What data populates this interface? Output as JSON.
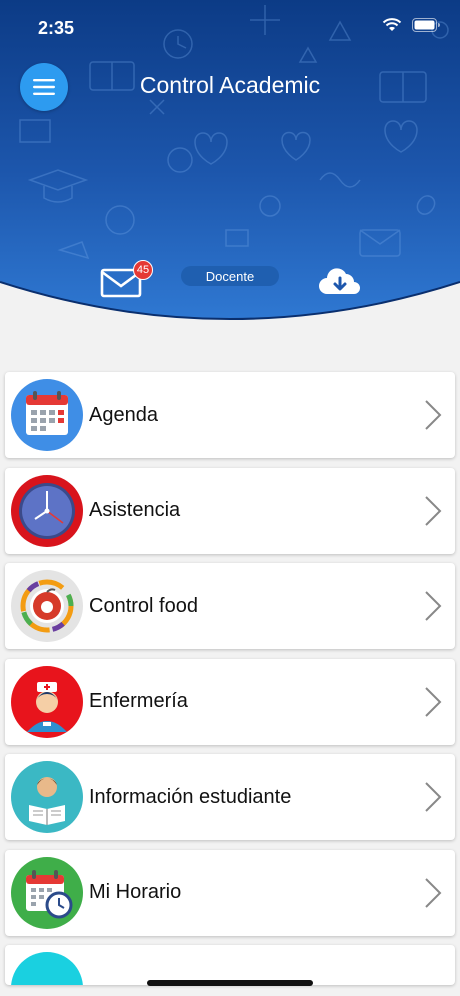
{
  "status_bar": {
    "time": "2:35"
  },
  "header": {
    "title": "Control Academic",
    "mail_badge_count": "45",
    "role": "Docente"
  },
  "menu_items": [
    {
      "label": "Agenda",
      "icon": "calendar-icon"
    },
    {
      "label": "Asistencia",
      "icon": "clock-icon"
    },
    {
      "label": "Control food",
      "icon": "apple-icon"
    },
    {
      "label": "Enfermería",
      "icon": "nurse-icon"
    },
    {
      "label": "Información estudiante",
      "icon": "student-reading-icon"
    },
    {
      "label": "Mi Horario",
      "icon": "schedule-icon"
    }
  ],
  "colors": {
    "header_dark": "#0d3f8f",
    "header_light": "#2a6fc9",
    "menu_button": "#2d9bf0",
    "badge": "#e53935"
  }
}
